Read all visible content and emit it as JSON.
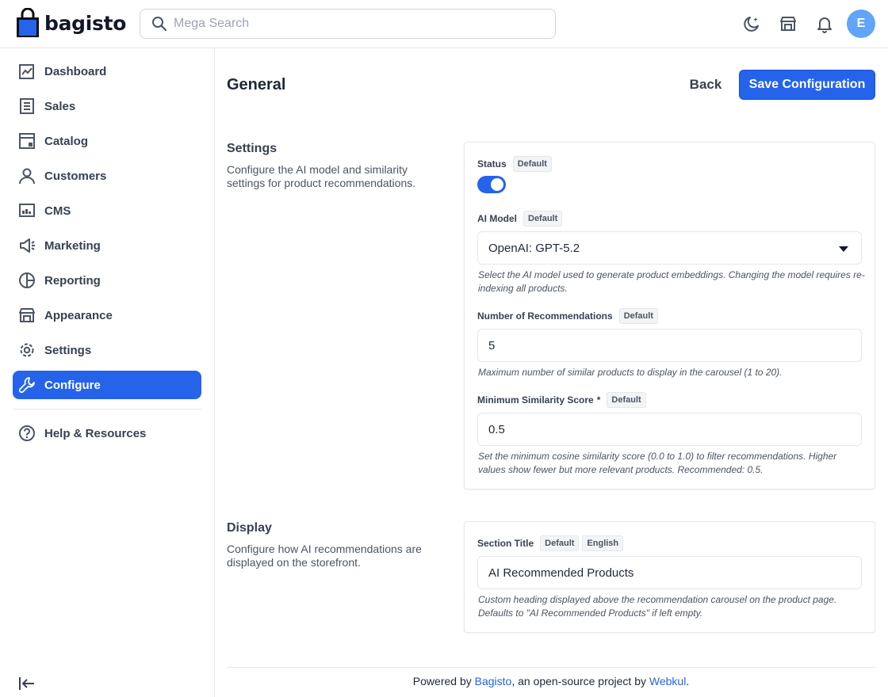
{
  "header": {
    "logo_text": "bagisto",
    "search_placeholder": "Mega Search",
    "avatar_initial": "E"
  },
  "sidebar": {
    "items": [
      {
        "label": "Dashboard",
        "icon": "dashboard-icon"
      },
      {
        "label": "Sales",
        "icon": "receipt-icon"
      },
      {
        "label": "Catalog",
        "icon": "catalog-icon"
      },
      {
        "label": "Customers",
        "icon": "user-icon"
      },
      {
        "label": "CMS",
        "icon": "cms-icon"
      },
      {
        "label": "Marketing",
        "icon": "megaphone-icon"
      },
      {
        "label": "Reporting",
        "icon": "pie-chart-icon"
      },
      {
        "label": "Appearance",
        "icon": "store-icon"
      },
      {
        "label": "Settings",
        "icon": "gear-icon"
      },
      {
        "label": "Configure",
        "icon": "wrench-icon",
        "active": true
      }
    ],
    "help_label": "Help & Resources"
  },
  "page": {
    "title": "General",
    "back_label": "Back",
    "save_label": "Save Configuration"
  },
  "settings_section": {
    "title": "Settings",
    "description": "Configure the AI model and similarity settings for product recommendations.",
    "status": {
      "label": "Status",
      "tag": "Default",
      "enabled": true
    },
    "ai_model": {
      "label": "AI Model",
      "tag": "Default",
      "value": "OpenAI: GPT-5.2",
      "hint": "Select the AI model used to generate product embeddings. Changing the model requires re-indexing all products."
    },
    "num_recommendations": {
      "label": "Number of Recommendations",
      "tag": "Default",
      "value": "5",
      "hint": "Maximum number of similar products to display in the carousel (1 to 20)."
    },
    "min_similarity": {
      "label": "Minimum Similarity Score",
      "required_mark": "*",
      "tag": "Default",
      "value": "0.5",
      "hint": "Set the minimum cosine similarity score (0.0 to 1.0) to filter recommendations. Higher values show fewer but more relevant products. Recommended: 0.5."
    }
  },
  "display_section": {
    "title": "Display",
    "description": "Configure how AI recommendations are displayed on the storefront.",
    "section_title": {
      "label": "Section Title",
      "tag": "Default",
      "tag_locale": "English",
      "value": "AI Recommended Products",
      "hint": "Custom heading displayed above the recommendation carousel on the product page. Defaults to \"AI Recommended Products\" if left empty."
    }
  },
  "footer": {
    "prefix": "Powered by",
    "brand": "Bagisto",
    "middle": ", an open-source project by",
    "company": "Webkul",
    "suffix": "."
  },
  "colors": {
    "accent": "#2563eb",
    "avatar": "#60a5fa"
  }
}
